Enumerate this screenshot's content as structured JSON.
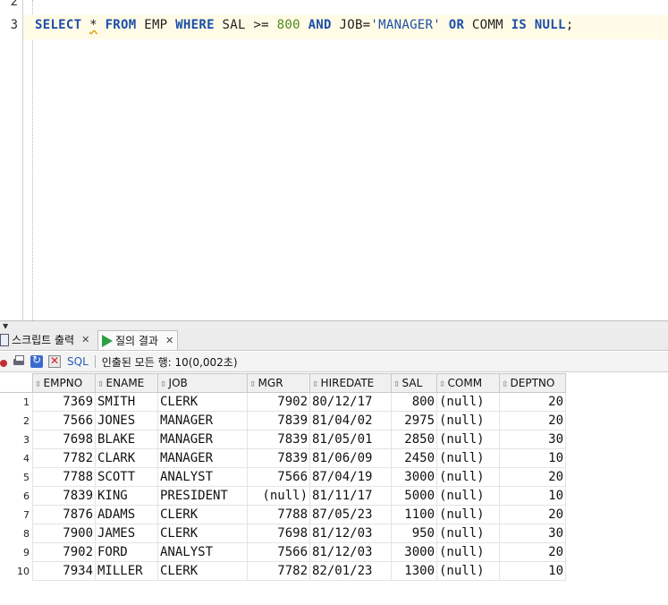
{
  "editor": {
    "line_numbers": [
      "2",
      "3"
    ],
    "sql_tokens": [
      {
        "t": "SELECT",
        "c": "kw"
      },
      {
        "t": " "
      },
      {
        "t": "*",
        "c": "star"
      },
      {
        "t": " "
      },
      {
        "t": "FROM",
        "c": "kw"
      },
      {
        "t": " EMP "
      },
      {
        "t": "WHERE",
        "c": "kw"
      },
      {
        "t": " SAL >= "
      },
      {
        "t": "800",
        "c": "num"
      },
      {
        "t": " "
      },
      {
        "t": "AND",
        "c": "kw"
      },
      {
        "t": " JOB="
      },
      {
        "t": "'MANAGER'",
        "c": "str"
      },
      {
        "t": " "
      },
      {
        "t": "OR",
        "c": "kw"
      },
      {
        "t": " COMM "
      },
      {
        "t": "IS",
        "c": "kw"
      },
      {
        "t": " "
      },
      {
        "t": "NULL",
        "c": "kw"
      },
      {
        "t": ";"
      }
    ]
  },
  "tabs": [
    {
      "label": "스크립트 출력",
      "icon": "script-output-icon",
      "active": false
    },
    {
      "label": "질의 결과",
      "icon": "run-icon",
      "active": true
    }
  ],
  "toolbar": {
    "sql_label": "SQL",
    "status": "인출된 모든 행: 10(0,002초)"
  },
  "grid": {
    "columns": [
      "EMPNO",
      "ENAME",
      "JOB",
      "MGR",
      "HIREDATE",
      "SAL",
      "COMM",
      "DEPTNO"
    ],
    "rows": [
      [
        "1",
        "7369",
        "SMITH",
        "CLERK",
        "7902",
        "80/12/17",
        "800",
        "(null)",
        "20"
      ],
      [
        "2",
        "7566",
        "JONES",
        "MANAGER",
        "7839",
        "81/04/02",
        "2975",
        "(null)",
        "20"
      ],
      [
        "3",
        "7698",
        "BLAKE",
        "MANAGER",
        "7839",
        "81/05/01",
        "2850",
        "(null)",
        "30"
      ],
      [
        "4",
        "7782",
        "CLARK",
        "MANAGER",
        "7839",
        "81/06/09",
        "2450",
        "(null)",
        "10"
      ],
      [
        "5",
        "7788",
        "SCOTT",
        "ANALYST",
        "7566",
        "87/04/19",
        "3000",
        "(null)",
        "20"
      ],
      [
        "6",
        "7839",
        "KING",
        "PRESIDENT",
        "(null)",
        "81/11/17",
        "5000",
        "(null)",
        "10"
      ],
      [
        "7",
        "7876",
        "ADAMS",
        "CLERK",
        "7788",
        "87/05/23",
        "1100",
        "(null)",
        "20"
      ],
      [
        "8",
        "7900",
        "JAMES",
        "CLERK",
        "7698",
        "81/12/03",
        "950",
        "(null)",
        "30"
      ],
      [
        "9",
        "7902",
        "FORD",
        "ANALYST",
        "7566",
        "81/12/03",
        "3000",
        "(null)",
        "20"
      ],
      [
        "10",
        "7934",
        "MILLER",
        "CLERK",
        "7782",
        "82/01/23",
        "1300",
        "(null)",
        "10"
      ]
    ]
  }
}
